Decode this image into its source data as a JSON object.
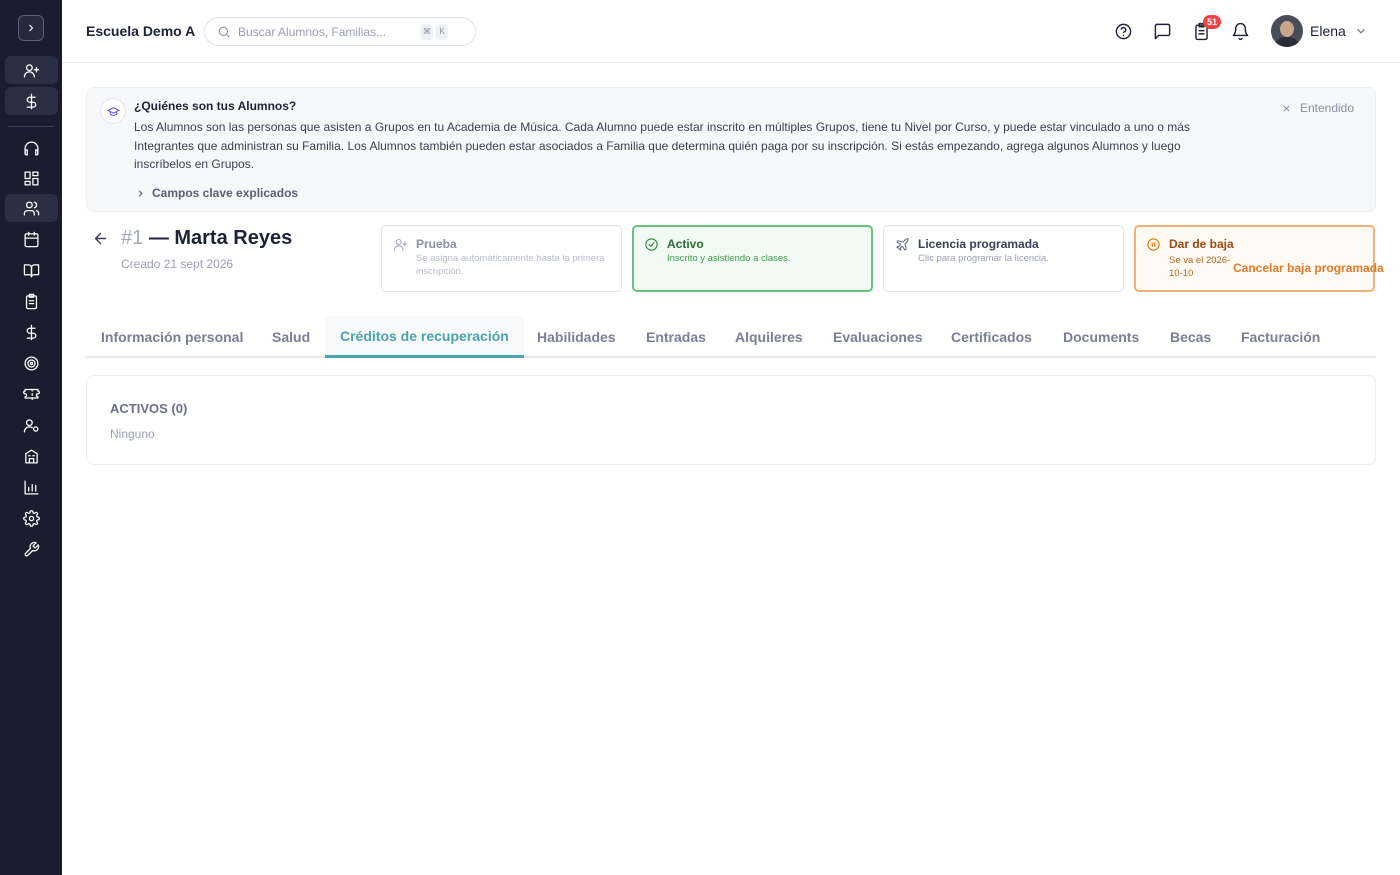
{
  "app": {
    "school_name": "Escuela Demo A",
    "search_placeholder": "Buscar Alumnos, Familias...",
    "search_shortcut": [
      "⌘",
      "K"
    ],
    "notifications_count": "51",
    "user_name": "Elena"
  },
  "sidebar": {
    "items": [
      {
        "icon": "user-plus-icon"
      },
      {
        "icon": "dollar-icon"
      },
      {
        "icon": "headphones-icon"
      },
      {
        "icon": "dashboard-grid-icon"
      },
      {
        "icon": "users-icon",
        "active": true
      },
      {
        "icon": "calendar-icon"
      },
      {
        "icon": "book-open-icon"
      },
      {
        "icon": "clipboard-icon"
      },
      {
        "icon": "dollar-icon"
      },
      {
        "icon": "target-icon"
      },
      {
        "icon": "ticket-icon"
      },
      {
        "icon": "user-settings-icon"
      },
      {
        "icon": "building-icon"
      },
      {
        "icon": "bar-chart-icon"
      },
      {
        "icon": "gear-icon"
      },
      {
        "icon": "wrench-icon"
      }
    ]
  },
  "info_banner": {
    "title": "¿Quiénes son tus Alumnos?",
    "text": "Los Alumnos son las personas que asisten a Grupos en tu Academia de Música. Cada Alumno puede estar inscrito en múltiples Grupos, tiene tu Nivel por Curso, y puede estar vinculado a uno o más Integrantes que administran su Familia. Los Alumnos también pueden estar asociados a Familia que determina quién paga por su inscripción. Si estás empezando, agrega algunos Alumnos y luego inscríbelos en Grupos.",
    "dismiss_label": "Entendido",
    "key_fields_label": "Campos clave explicados"
  },
  "student": {
    "number": "#1",
    "name": "— Marta Reyes",
    "created": "Creado 21 sept 2026"
  },
  "status_cards": {
    "trial": {
      "title": "Prueba",
      "subtitle": "Se asigna automáticamente hasta la primera inscripción."
    },
    "active": {
      "title": "Activo",
      "subtitle": "Inscrito y asistiendo a clases."
    },
    "leave": {
      "title": "Licencia programada",
      "subtitle": "Clic para programar la licencia."
    },
    "drop": {
      "title": "Dar de baja",
      "subtitle": "Se va el 2026-10-10",
      "cancel_label": "Cancelar baja programada"
    }
  },
  "tabs": [
    "Información personal",
    "Salud",
    "Créditos de recuperación",
    "Habilidades",
    "Entradas",
    "Alquileres",
    "Evaluaciones",
    "Certificados",
    "Documents",
    "Becas",
    "Facturación"
  ],
  "active_tab": "Créditos de recuperación",
  "credits": {
    "section_title": "ACTIVOS (0)",
    "empty_text": "Ninguno"
  }
}
